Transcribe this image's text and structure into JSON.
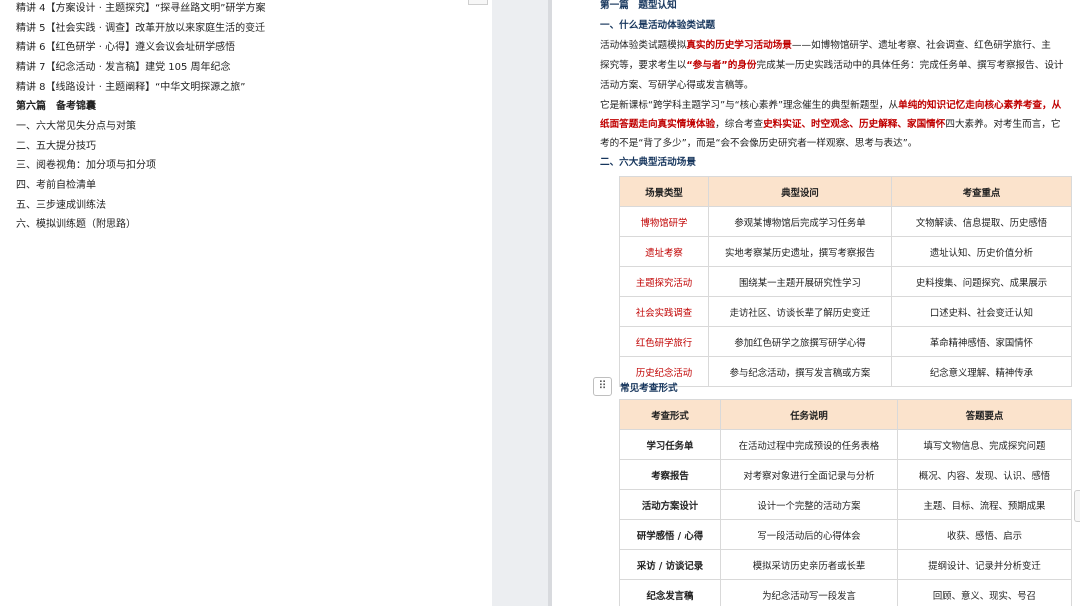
{
  "toc": {
    "items": [
      "精讲 4【方案设计 · 主题探究】“探寻丝路文明”研学方案",
      "精讲 5【社会实践 · 调查】改革开放以来家庭生活的变迁",
      "精讲 6【红色研学 · 心得】遵义会议会址研学感悟",
      "精讲 7【纪念活动 · 发言稿】建党 105 周年纪念",
      "精讲 8【线路设计 · 主题阐释】“中华文明探源之旅”"
    ],
    "section_title": "第六篇　备考锦囊",
    "section_items": [
      "一、六大常见失分点与对策",
      "二、五大提分技巧",
      "三、阅卷视角：加分项与扣分项",
      "四、考前自检清单",
      "五、三步速成训练法",
      "六、模拟训练题（附思路）"
    ]
  },
  "doc": {
    "part_title": "第一篇　题型认知",
    "h1": "一、什么是活动体验类试题",
    "p1_line1_a": "活动体验类试题模拟",
    "p1_line1_red": "真实的历史学习活动场景",
    "p1_line1_b": "——如博物馆研学、遗址考察、社会调查、红色研学旅行、主",
    "p1_line2_a": "探究等，要求考生以",
    "p1_line2_red": "“参与者”的身份",
    "p1_line2_b": "完成某一历史实践活动中的具体任务：完成任务单、撰写考察报告、设计",
    "p1_line3": "活动方案、写研学心得或发言稿等。",
    "p2_line1_a": "它是新课标“跨学科主题学习”与“核心素养”理念催生的典型新题型，从",
    "p2_line1_red": "单纯的知识记忆走向核心素养考查，从",
    "p2_line2_red1": "纸面答题走向真实情境体验",
    "p2_line2_b": "，综合考查",
    "p2_line2_red2": "史料实证、时空观念、历史解释、家国情怀",
    "p2_line2_c": "四大素养。对考生而言，它",
    "p2_line3": "考的不是“背了多少”，而是“会不会像历史研究者一样观察、思考与表达”。",
    "h2": "二、六大典型活动场景",
    "h3": "常见考查形式"
  },
  "table1": {
    "headers": [
      "场景类型",
      "典型设问",
      "考查重点"
    ],
    "rows": [
      [
        "博物馆研学",
        "参观某博物馆后完成学习任务单",
        "文物解读、信息提取、历史感悟"
      ],
      [
        "遗址考察",
        "实地考察某历史遗址，撰写考察报告",
        "遗址认知、历史价值分析"
      ],
      [
        "主题探究活动",
        "围绕某一主题开展研究性学习",
        "史料搜集、问题探究、成果展示"
      ],
      [
        "社会实践调查",
        "走访社区、访谈长辈了解历史变迁",
        "口述史料、社会变迁认知"
      ],
      [
        "红色研学旅行",
        "参加红色研学之旅撰写研学心得",
        "革命精神感悟、家国情怀"
      ],
      [
        "历史纪念活动",
        "参与纪念活动，撰写发言稿或方案",
        "纪念意义理解、精神传承"
      ]
    ]
  },
  "table2": {
    "headers": [
      "考查形式",
      "任务说明",
      "答题要点"
    ],
    "rows": [
      [
        "学习任务单",
        "在活动过程中完成预设的任务表格",
        "填写文物信息、完成探究问题"
      ],
      [
        "考察报告",
        "对考察对象进行全面记录与分析",
        "概况、内容、发现、认识、感悟"
      ],
      [
        "活动方案设计",
        "设计一个完整的活动方案",
        "主题、目标、流程、预期成果"
      ],
      [
        "研学感悟 / 心得",
        "写一段活动后的心得体会",
        "收获、感悟、启示"
      ],
      [
        "采访 / 访谈记录",
        "模拟采访历史亲历者或长辈",
        "提纲设计、记录并分析变迁"
      ],
      [
        "纪念发言稿",
        "为纪念活动写一段发言",
        "回顾、意义、现实、号召"
      ]
    ]
  },
  "handle_glyph": "⠿",
  "colors": {
    "red": "#c00000",
    "heading_blue": "#17365d",
    "table_header_bg": "#fbe3cc"
  }
}
